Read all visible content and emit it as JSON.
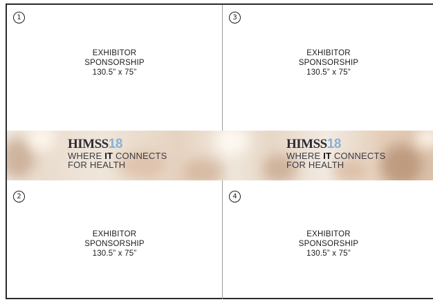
{
  "panels": [
    {
      "number": "1",
      "line1": "EXHIBITOR",
      "line2": "SPONSORSHIP",
      "size": "130.5” x 75”"
    },
    {
      "number": "3",
      "line1": "EXHIBITOR",
      "line2": "SPONSORSHIP",
      "size": "130.5” x 75”"
    },
    {
      "number": "2",
      "line1": "EXHIBITOR",
      "line2": "SPONSORSHIP",
      "size": "130.5” x 75”"
    },
    {
      "number": "4",
      "line1": "EXHIBITOR",
      "line2": "SPONSORSHIP",
      "size": "130.5” x 75”"
    }
  ],
  "banner": {
    "brand": "HIMSS",
    "year": "18",
    "tagline_pre": "WHERE ",
    "tagline_bold": "IT",
    "tagline_post": " CONNECTS",
    "tagline_line2": "FOR HEALTH"
  },
  "colors": {
    "year_accent": "#8ab0d6",
    "border": "#2a2a2a",
    "divider": "#9a9a9a"
  }
}
